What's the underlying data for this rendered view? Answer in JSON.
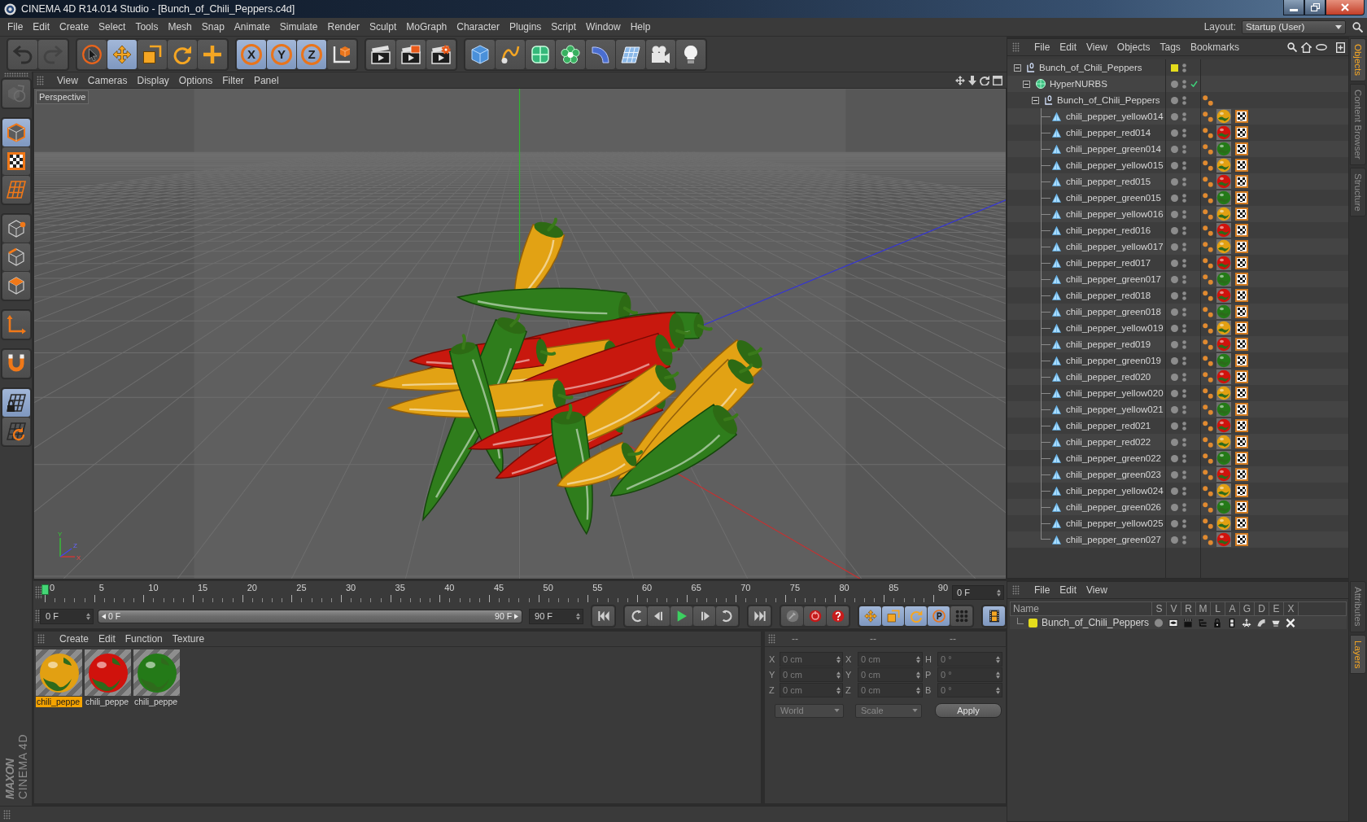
{
  "window": {
    "title": "CINEMA 4D R14.014 Studio - [Bunch_of_Chili_Peppers.c4d]"
  },
  "menubar": {
    "items": [
      "File",
      "Edit",
      "Create",
      "Select",
      "Tools",
      "Mesh",
      "Snap",
      "Animate",
      "Simulate",
      "Render",
      "Sculpt",
      "MoGraph",
      "Character",
      "Plugins",
      "Script",
      "Window",
      "Help"
    ],
    "layout_label": "Layout:",
    "layout_value": "Startup (User)"
  },
  "toolbar": {
    "groups": [
      [
        {
          "kind": "undo",
          "selected": false,
          "disabled": false
        },
        {
          "kind": "redo",
          "selected": false,
          "disabled": true
        }
      ],
      [
        {
          "kind": "select",
          "selected": false,
          "disabled": false
        },
        {
          "kind": "move",
          "selected": true,
          "disabled": false
        },
        {
          "kind": "scale",
          "selected": false,
          "disabled": false
        },
        {
          "kind": "rotate",
          "selected": false,
          "disabled": false
        },
        {
          "kind": "recent",
          "selected": false,
          "disabled": false
        }
      ],
      [
        {
          "kind": "axis",
          "label": "X",
          "selected": true,
          "disabled": false
        },
        {
          "kind": "axis",
          "label": "Y",
          "selected": true,
          "disabled": false
        },
        {
          "kind": "axis",
          "label": "Z",
          "selected": true,
          "disabled": false
        },
        {
          "kind": "coordinates",
          "selected": false,
          "disabled": false
        }
      ],
      [
        {
          "kind": "render_view",
          "selected": false,
          "disabled": false
        },
        {
          "kind": "render_picture",
          "selected": false,
          "disabled": false
        },
        {
          "kind": "render_settings",
          "selected": false,
          "disabled": false
        }
      ],
      [
        {
          "kind": "cube",
          "selected": false,
          "disabled": false
        },
        {
          "kind": "spline",
          "selected": false,
          "disabled": false
        },
        {
          "kind": "nurbs",
          "selected": false,
          "disabled": false
        },
        {
          "kind": "cloner",
          "selected": false,
          "disabled": false
        },
        {
          "kind": "deformer",
          "selected": false,
          "disabled": false
        },
        {
          "kind": "floor",
          "selected": false,
          "disabled": false
        },
        {
          "kind": "camera",
          "selected": false,
          "disabled": false
        },
        {
          "kind": "light",
          "selected": false,
          "disabled": false
        }
      ]
    ]
  },
  "tool_column": {
    "groups": [
      [
        {
          "kind": "make_editable",
          "selected": false,
          "disabled": true
        }
      ],
      [
        {
          "kind": "model",
          "selected": true,
          "disabled": false
        },
        {
          "kind": "texture",
          "selected": false,
          "disabled": false
        },
        {
          "kind": "workplane",
          "selected": false,
          "disabled": false
        }
      ],
      [
        {
          "kind": "points",
          "selected": false,
          "disabled": false
        },
        {
          "kind": "edges",
          "selected": false,
          "disabled": false
        },
        {
          "kind": "polygons",
          "selected": false,
          "disabled": false
        }
      ],
      [
        {
          "kind": "axis_mode",
          "selected": false,
          "disabled": false
        }
      ],
      [
        {
          "kind": "snap",
          "selected": false,
          "disabled": false
        }
      ],
      [
        {
          "kind": "grid_lock",
          "selected": true,
          "disabled": false
        },
        {
          "kind": "grid_rotate",
          "selected": false,
          "disabled": false
        }
      ]
    ],
    "logo": [
      "MAXON",
      "CINEMA 4D"
    ]
  },
  "viewport": {
    "menu": [
      "View",
      "Cameras",
      "Display",
      "Options",
      "Filter",
      "Panel"
    ],
    "camera": "Perspective",
    "axis_labels": [
      "Y",
      "Z",
      "X"
    ]
  },
  "timeline": {
    "ticks": [
      "0",
      "5",
      "10",
      "15",
      "20",
      "25",
      "30",
      "35",
      "40",
      "45",
      "50",
      "55",
      "60",
      "65",
      "70",
      "75",
      "80",
      "85",
      "90"
    ],
    "level": 0,
    "frame": "0 F"
  },
  "transport": {
    "start": "0 F",
    "range": {
      "level": 1,
      "start": "0 F",
      "end": "90 F"
    },
    "end": "90 F",
    "groups": [
      [
        {
          "kind": "go_start",
          "selected": false
        }
      ],
      [
        {
          "kind": "prev_key",
          "selected": false
        },
        {
          "kind": "prev_frame",
          "selected": false
        },
        {
          "kind": "play",
          "selected": false
        },
        {
          "kind": "next_frame",
          "selected": false
        },
        {
          "kind": "next_key",
          "selected": false
        }
      ],
      [
        {
          "kind": "go_end",
          "selected": false
        }
      ],
      [
        {
          "kind": "record",
          "selected": false
        },
        {
          "kind": "autokey",
          "selected": false
        },
        {
          "kind": "key_help",
          "selected": false
        }
      ],
      [
        {
          "kind": "rec_position",
          "selected": true
        },
        {
          "kind": "rec_scale",
          "selected": true
        },
        {
          "kind": "rec_rotation",
          "selected": true
        },
        {
          "kind": "rec_parameter",
          "selected": true
        },
        {
          "kind": "rec_points",
          "selected": false
        }
      ],
      [
        {
          "kind": "timeline",
          "selected": true
        }
      ]
    ]
  },
  "materials": {
    "menu": [
      "Create",
      "Edit",
      "Function",
      "Texture"
    ],
    "items": [
      {
        "name": "chili_peppe",
        "color": "#e2a012",
        "selected": true
      },
      {
        "name": "chili_peppe",
        "color": "#d0120c",
        "selected": false
      },
      {
        "name": "chili_peppe",
        "color": "#247a18",
        "selected": false
      }
    ]
  },
  "coordinates": {
    "headers": [
      "--",
      "--",
      "--"
    ],
    "rows": [
      {
        "axis": "X",
        "position": "0 cm",
        "size_axis": "X",
        "size": "0 cm",
        "rotation_axis": "H",
        "rotation": "0 °"
      },
      {
        "axis": "Y",
        "position": "0 cm",
        "size_axis": "Y",
        "size": "0 cm",
        "rotation_axis": "P",
        "rotation": "0 °"
      },
      {
        "axis": "Z",
        "position": "0 cm",
        "size_axis": "Z",
        "size": "0 cm",
        "rotation_axis": "B",
        "rotation": "0 °"
      }
    ],
    "mode": "World",
    "size_mode": "Scale",
    "apply": "Apply"
  },
  "objects": {
    "menu": [
      "File",
      "Edit",
      "View",
      "Objects",
      "Tags",
      "Bookmarks"
    ],
    "tree": [
      {
        "name": "Bunch_of_Chili_Peppers",
        "kind": "null",
        "expanded": true,
        "selected": false,
        "color": "#e4dc1c",
        "children": [
          {
            "name": "HyperNURBS",
            "kind": "hypernurbs",
            "expanded": true,
            "selected": false,
            "enabled": true,
            "children": [
              {
                "name": "Bunch_of_Chili_Peppers",
                "kind": "null",
                "expanded": true,
                "selected": false,
                "tags": [
                  {
                    "kind": "phong"
                  }
                ],
                "children": [
                  {
                    "name": "chili_pepper_yellow014",
                    "kind": "polygon",
                    "selected": false,
                    "tags": [
                      {
                        "kind": "phong"
                      },
                      {
                        "kind": "material",
                        "color": "#e2a012"
                      },
                      {
                        "kind": "uvw"
                      }
                    ]
                  },
                  {
                    "name": "chili_pepper_red014",
                    "kind": "polygon",
                    "selected": false,
                    "tags": [
                      {
                        "kind": "phong"
                      },
                      {
                        "kind": "material",
                        "color": "#d0120c"
                      },
                      {
                        "kind": "uvw"
                      }
                    ]
                  },
                  {
                    "name": "chili_pepper_green014",
                    "kind": "polygon",
                    "selected": false,
                    "tags": [
                      {
                        "kind": "phong"
                      },
                      {
                        "kind": "material",
                        "color": "#247a18"
                      },
                      {
                        "kind": "uvw"
                      }
                    ]
                  },
                  {
                    "name": "chili_pepper_yellow015",
                    "kind": "polygon",
                    "selected": false,
                    "tags": [
                      {
                        "kind": "phong"
                      },
                      {
                        "kind": "material",
                        "color": "#e2a012"
                      },
                      {
                        "kind": "uvw"
                      }
                    ]
                  },
                  {
                    "name": "chili_pepper_red015",
                    "kind": "polygon",
                    "selected": false,
                    "tags": [
                      {
                        "kind": "phong"
                      },
                      {
                        "kind": "material",
                        "color": "#d0120c"
                      },
                      {
                        "kind": "uvw"
                      }
                    ]
                  },
                  {
                    "name": "chili_pepper_green015",
                    "kind": "polygon",
                    "selected": false,
                    "tags": [
                      {
                        "kind": "phong"
                      },
                      {
                        "kind": "material",
                        "color": "#247a18"
                      },
                      {
                        "kind": "uvw"
                      }
                    ]
                  },
                  {
                    "name": "chili_pepper_yellow016",
                    "kind": "polygon",
                    "selected": false,
                    "tags": [
                      {
                        "kind": "phong"
                      },
                      {
                        "kind": "material",
                        "color": "#e2a012"
                      },
                      {
                        "kind": "uvw"
                      }
                    ]
                  },
                  {
                    "name": "chili_pepper_red016",
                    "kind": "polygon",
                    "selected": false,
                    "tags": [
                      {
                        "kind": "phong"
                      },
                      {
                        "kind": "material",
                        "color": "#d0120c"
                      },
                      {
                        "kind": "uvw"
                      }
                    ]
                  },
                  {
                    "name": "chili_pepper_yellow017",
                    "kind": "polygon",
                    "selected": false,
                    "tags": [
                      {
                        "kind": "phong"
                      },
                      {
                        "kind": "material",
                        "color": "#e2a012"
                      },
                      {
                        "kind": "uvw"
                      }
                    ]
                  },
                  {
                    "name": "chili_pepper_red017",
                    "kind": "polygon",
                    "selected": false,
                    "tags": [
                      {
                        "kind": "phong"
                      },
                      {
                        "kind": "material",
                        "color": "#d0120c"
                      },
                      {
                        "kind": "uvw"
                      }
                    ]
                  },
                  {
                    "name": "chili_pepper_green017",
                    "kind": "polygon",
                    "selected": false,
                    "tags": [
                      {
                        "kind": "phong"
                      },
                      {
                        "kind": "material",
                        "color": "#247a18"
                      },
                      {
                        "kind": "uvw"
                      }
                    ]
                  },
                  {
                    "name": "chili_pepper_red018",
                    "kind": "polygon",
                    "selected": false,
                    "tags": [
                      {
                        "kind": "phong"
                      },
                      {
                        "kind": "material",
                        "color": "#d0120c"
                      },
                      {
                        "kind": "uvw"
                      }
                    ]
                  },
                  {
                    "name": "chili_pepper_green018",
                    "kind": "polygon",
                    "selected": false,
                    "tags": [
                      {
                        "kind": "phong"
                      },
                      {
                        "kind": "material",
                        "color": "#247a18"
                      },
                      {
                        "kind": "uvw"
                      }
                    ]
                  },
                  {
                    "name": "chili_pepper_yellow019",
                    "kind": "polygon",
                    "selected": false,
                    "tags": [
                      {
                        "kind": "phong"
                      },
                      {
                        "kind": "material",
                        "color": "#e2a012"
                      },
                      {
                        "kind": "uvw"
                      }
                    ]
                  },
                  {
                    "name": "chili_pepper_red019",
                    "kind": "polygon",
                    "selected": false,
                    "tags": [
                      {
                        "kind": "phong"
                      },
                      {
                        "kind": "material",
                        "color": "#d0120c"
                      },
                      {
                        "kind": "uvw"
                      }
                    ]
                  },
                  {
                    "name": "chili_pepper_green019",
                    "kind": "polygon",
                    "selected": false,
                    "tags": [
                      {
                        "kind": "phong"
                      },
                      {
                        "kind": "material",
                        "color": "#247a18"
                      },
                      {
                        "kind": "uvw"
                      }
                    ]
                  },
                  {
                    "name": "chili_pepper_red020",
                    "kind": "polygon",
                    "selected": false,
                    "tags": [
                      {
                        "kind": "phong"
                      },
                      {
                        "kind": "material",
                        "color": "#d0120c"
                      },
                      {
                        "kind": "uvw"
                      }
                    ]
                  },
                  {
                    "name": "chili_pepper_yellow020",
                    "kind": "polygon",
                    "selected": false,
                    "tags": [
                      {
                        "kind": "phong"
                      },
                      {
                        "kind": "material",
                        "color": "#e2a012"
                      },
                      {
                        "kind": "uvw"
                      }
                    ]
                  },
                  {
                    "name": "chili_pepper_yellow021",
                    "kind": "polygon",
                    "selected": false,
                    "tags": [
                      {
                        "kind": "phong"
                      },
                      {
                        "kind": "material",
                        "color": "#247a18"
                      },
                      {
                        "kind": "uvw"
                      }
                    ]
                  },
                  {
                    "name": "chili_pepper_red021",
                    "kind": "polygon",
                    "selected": false,
                    "tags": [
                      {
                        "kind": "phong"
                      },
                      {
                        "kind": "material",
                        "color": "#d0120c"
                      },
                      {
                        "kind": "uvw"
                      }
                    ]
                  },
                  {
                    "name": "chili_pepper_red022",
                    "kind": "polygon",
                    "selected": false,
                    "tags": [
                      {
                        "kind": "phong"
                      },
                      {
                        "kind": "material",
                        "color": "#e2a012"
                      },
                      {
                        "kind": "uvw"
                      }
                    ]
                  },
                  {
                    "name": "chili_pepper_green022",
                    "kind": "polygon",
                    "selected": false,
                    "tags": [
                      {
                        "kind": "phong"
                      },
                      {
                        "kind": "material",
                        "color": "#247a18"
                      },
                      {
                        "kind": "uvw"
                      }
                    ]
                  },
                  {
                    "name": "chili_pepper_green023",
                    "kind": "polygon",
                    "selected": false,
                    "tags": [
                      {
                        "kind": "phong"
                      },
                      {
                        "kind": "material",
                        "color": "#d0120c"
                      },
                      {
                        "kind": "uvw"
                      }
                    ]
                  },
                  {
                    "name": "chili_pepper_yellow024",
                    "kind": "polygon",
                    "selected": false,
                    "tags": [
                      {
                        "kind": "phong"
                      },
                      {
                        "kind": "material",
                        "color": "#e2a012"
                      },
                      {
                        "kind": "uvw"
                      }
                    ]
                  },
                  {
                    "name": "chili_pepper_green026",
                    "kind": "polygon",
                    "selected": false,
                    "tags": [
                      {
                        "kind": "phong"
                      },
                      {
                        "kind": "material",
                        "color": "#247a18"
                      },
                      {
                        "kind": "uvw"
                      }
                    ]
                  },
                  {
                    "name": "chili_pepper_yellow025",
                    "kind": "polygon",
                    "selected": false,
                    "tags": [
                      {
                        "kind": "phong"
                      },
                      {
                        "kind": "material",
                        "color": "#e2a012"
                      },
                      {
                        "kind": "uvw"
                      }
                    ]
                  },
                  {
                    "name": "chili_pepper_green027",
                    "kind": "polygon",
                    "selected": false,
                    "tags": [
                      {
                        "kind": "phong"
                      },
                      {
                        "kind": "material",
                        "color": "#d0120c"
                      },
                      {
                        "kind": "uvw"
                      }
                    ]
                  }
                ]
              }
            ]
          }
        ]
      }
    ]
  },
  "layers": {
    "menu": [
      "File",
      "Edit",
      "View"
    ],
    "columns": [
      "Name",
      "S",
      "V",
      "R",
      "M",
      "L",
      "A",
      "G",
      "D",
      "E",
      "X"
    ],
    "rows": [
      {
        "name": "Bunch_of_Chili_Peppers",
        "color": "#e4dc1c",
        "selected": false
      }
    ]
  },
  "side_tabs": {
    "top": [
      {
        "label": "Objects",
        "selected": true
      },
      {
        "label": "Content Browser",
        "selected": false
      },
      {
        "label": "Structure",
        "selected": false
      }
    ],
    "bottom": [
      {
        "label": "Attributes",
        "selected": false
      },
      {
        "label": "Layers",
        "selected": true
      }
    ]
  }
}
